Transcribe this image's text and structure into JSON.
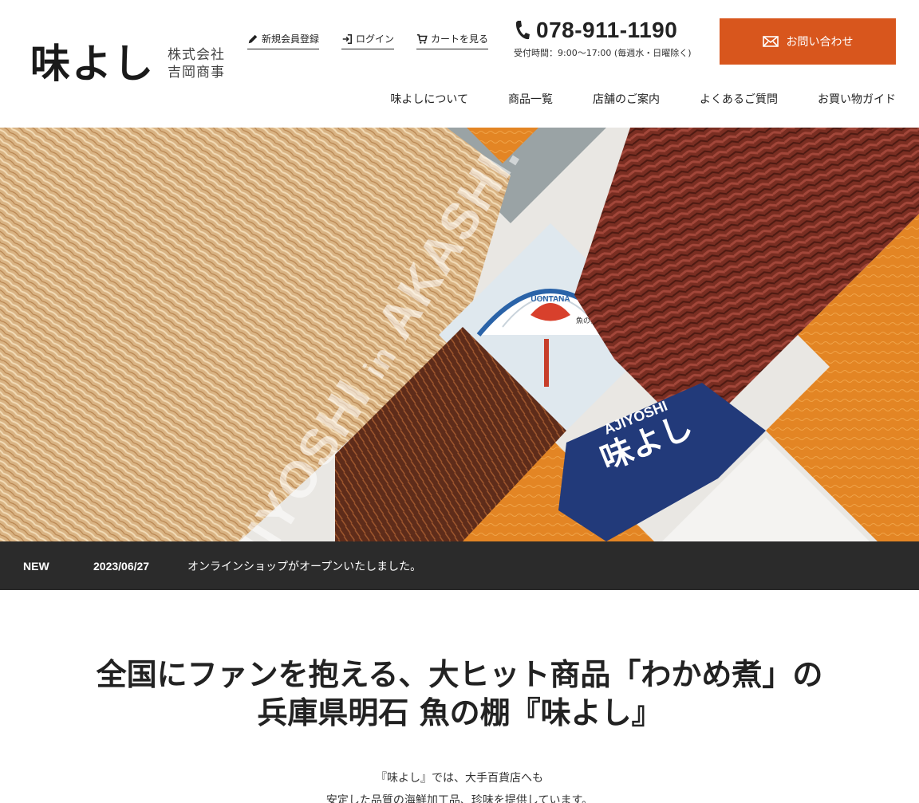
{
  "logo": {
    "main": "味よし",
    "sub_line1": "株式会社",
    "sub_line2": "吉岡商事"
  },
  "utility": [
    {
      "label": "新規会員登録",
      "icon": "pencil-icon"
    },
    {
      "label": "ログイン",
      "icon": "login-icon"
    },
    {
      "label": "カートを見る",
      "icon": "cart-icon"
    }
  ],
  "phone": {
    "number": "078-911-1190",
    "hours": "受付時間：9:00〜17:00 (毎週水・日曜除く)",
    "icon": "phone-icon"
  },
  "contact": {
    "label": "お問い合わせ",
    "icon": "mail-icon"
  },
  "nav": [
    {
      "label": "味よしについて"
    },
    {
      "label": "商品一覧"
    },
    {
      "label": "店舗のご案内"
    },
    {
      "label": "よくあるご質問"
    },
    {
      "label": "お買い物ガイド"
    }
  ],
  "hero": {
    "watermark_main": "AJIYOSHI",
    "watermark_in": "in",
    "watermark_place": "AKASHI.",
    "sign_text": "AJIYOSHI",
    "sign_kanji": "味よし",
    "arch_text": "UONTANA",
    "arch_kanji": "魚の棚",
    "accent_color": "#e0821f"
  },
  "news": {
    "tag": "NEW",
    "date": "2023/06/27",
    "text": "オンラインショップがオープンいたしました。"
  },
  "intro": {
    "title_line1": "全国にファンを抱える、大ヒット商品「わかめ煮」の",
    "title_line2": "兵庫県明石 魚の棚『味よし』",
    "body_line1": "『味よし』では、大手百貨店へも",
    "body_line2": "安定した品質の海鮮加工品、珍味を提供しています。"
  }
}
